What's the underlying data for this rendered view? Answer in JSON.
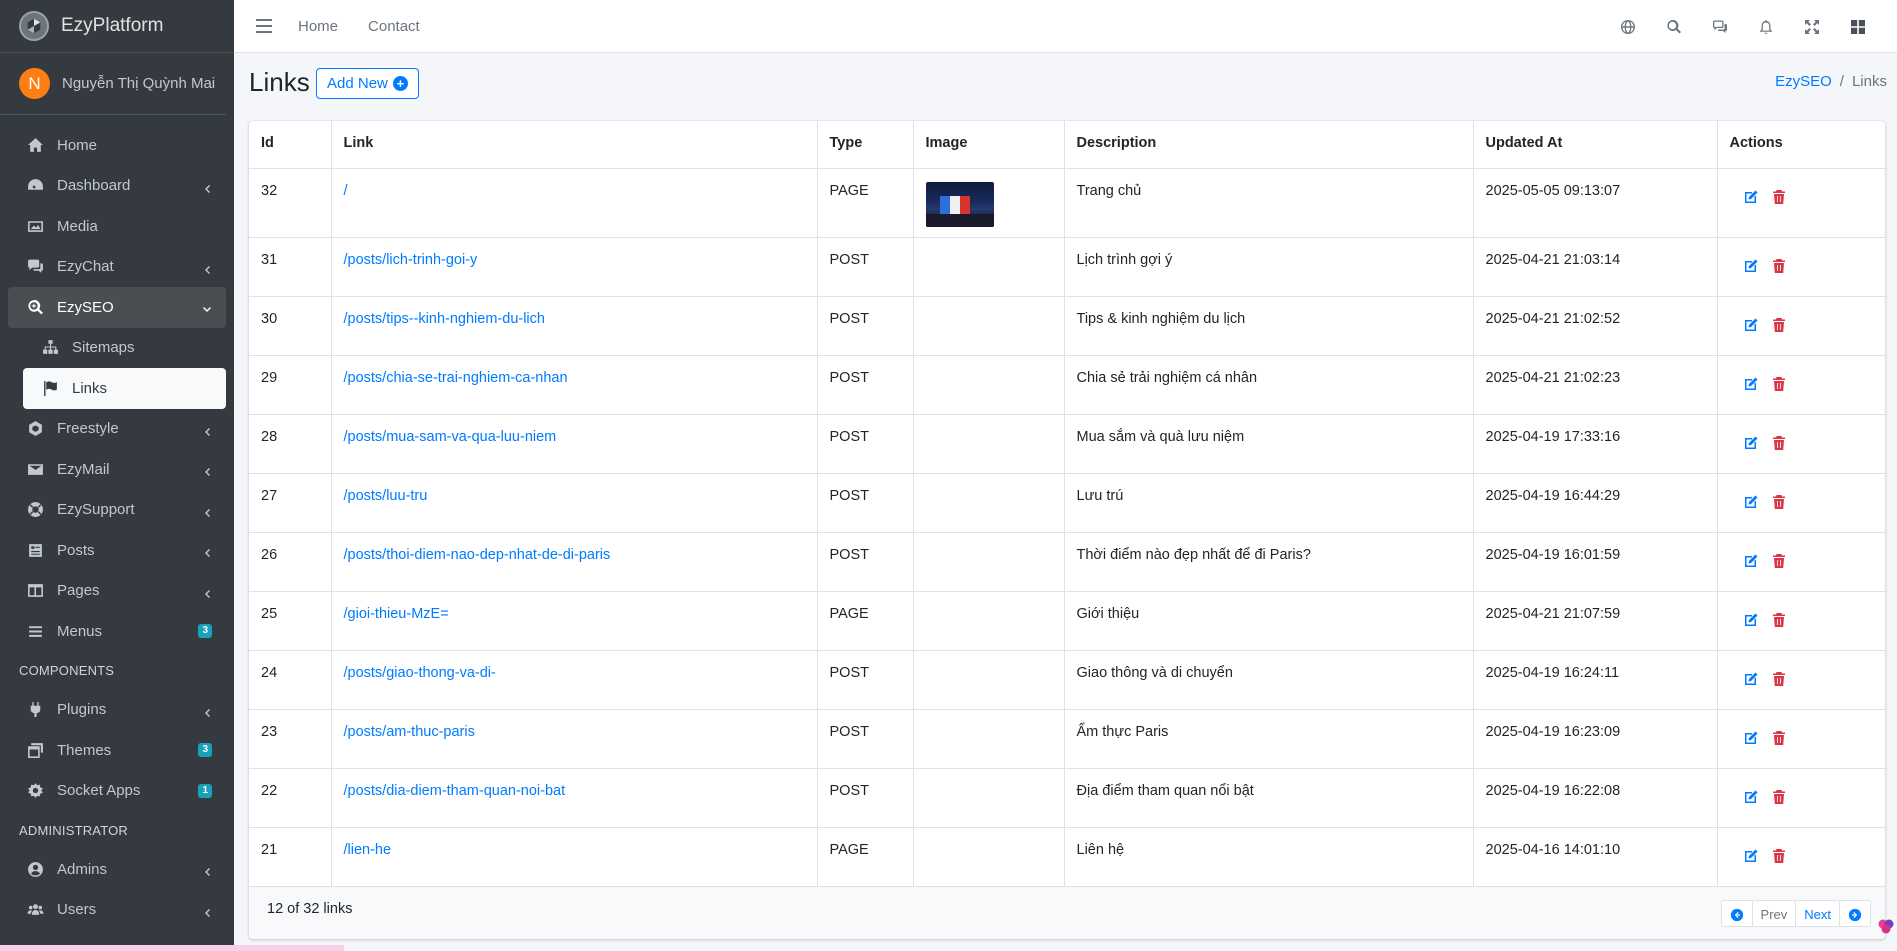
{
  "brand": {
    "name": "EzyPlatform"
  },
  "user": {
    "initial": "N",
    "name": "Nguyễn Thị Quỳnh Mai"
  },
  "sidebar": {
    "items": [
      {
        "label": "Home",
        "icon": "home-icon"
      },
      {
        "label": "Dashboard",
        "icon": "dashboard-icon"
      },
      {
        "label": "Media",
        "icon": "image-icon"
      },
      {
        "label": "EzyChat",
        "icon": "chat-icon"
      },
      {
        "label": "EzySEO",
        "icon": "search-plus-icon"
      },
      {
        "label": "Sitemaps",
        "icon": "sitemap-icon"
      },
      {
        "label": "Links",
        "icon": "flag-icon"
      },
      {
        "label": "Freestyle",
        "icon": "freestyle-icon"
      },
      {
        "label": "EzyMail",
        "icon": "mail-icon"
      },
      {
        "label": "EzySupport",
        "icon": "support-icon"
      },
      {
        "label": "Posts",
        "icon": "posts-icon"
      },
      {
        "label": "Pages",
        "icon": "pages-icon"
      },
      {
        "label": "Menus",
        "icon": "menu-icon",
        "badge": "3"
      }
    ],
    "components_header": "COMPONENTS",
    "components": [
      {
        "label": "Plugins",
        "icon": "plug-icon"
      },
      {
        "label": "Themes",
        "icon": "themes-icon",
        "badge": "3"
      },
      {
        "label": "Socket Apps",
        "icon": "socket-icon",
        "badge": "1"
      }
    ],
    "admin_header": "ADMINISTRATOR",
    "admin": [
      {
        "label": "Admins",
        "icon": "admin-icon"
      },
      {
        "label": "Users",
        "icon": "users-icon"
      }
    ]
  },
  "topbar": {
    "home": "Home",
    "contact": "Contact"
  },
  "page": {
    "title": "Links",
    "add_new": "Add New"
  },
  "breadcrumb": {
    "parent": "EzySEO",
    "sep": "/",
    "current": "Links"
  },
  "table": {
    "headers": [
      "Id",
      "Link",
      "Type",
      "Image",
      "Description",
      "Updated At",
      "Actions"
    ],
    "rows": [
      {
        "id": "32",
        "link": "/",
        "type": "PAGE",
        "description": "Trang chủ",
        "updated": "2025-05-05 09:13:07"
      },
      {
        "id": "31",
        "link": "/posts/lich-trinh-goi-y",
        "type": "POST",
        "description": "Lịch trình gợi ý",
        "updated": "2025-04-21 21:03:14"
      },
      {
        "id": "30",
        "link": "/posts/tips--kinh-nghiem-du-lich",
        "type": "POST",
        "description": "Tips & kinh nghiệm du lịch",
        "updated": "2025-04-21 21:02:52"
      },
      {
        "id": "29",
        "link": "/posts/chia-se-trai-nghiem-ca-nhan",
        "type": "POST",
        "description": "Chia sẻ trải nghiệm cá nhân",
        "updated": "2025-04-21 21:02:23"
      },
      {
        "id": "28",
        "link": "/posts/mua-sam-va-qua-luu-niem",
        "type": "POST",
        "description": "Mua sắm và quà lưu niệm",
        "updated": "2025-04-19 17:33:16"
      },
      {
        "id": "27",
        "link": "/posts/luu-tru",
        "type": "POST",
        "description": "Lưu trú",
        "updated": "2025-04-19 16:44:29"
      },
      {
        "id": "26",
        "link": "/posts/thoi-diem-nao-dep-nhat-de-di-paris",
        "type": "POST",
        "description": "Thời điểm nào đẹp nhất để đi Paris?",
        "updated": "2025-04-19 16:01:59"
      },
      {
        "id": "25",
        "link": "/gioi-thieu-MzE=",
        "type": "PAGE",
        "description": "Giới thiệu",
        "updated": "2025-04-21 21:07:59"
      },
      {
        "id": "24",
        "link": "/posts/giao-thong-va-di-",
        "type": "POST",
        "description": "Giao thông và di chuyển",
        "updated": "2025-04-19 16:24:11"
      },
      {
        "id": "23",
        "link": "/posts/am-thuc-paris",
        "type": "POST",
        "description": "Ẩm thực Paris",
        "updated": "2025-04-19 16:23:09"
      },
      {
        "id": "22",
        "link": "/posts/dia-diem-tham-quan-noi-bat",
        "type": "POST",
        "description": "Địa điểm tham quan nổi bật",
        "updated": "2025-04-19 16:22:08"
      },
      {
        "id": "21",
        "link": "/lien-he",
        "type": "PAGE",
        "description": "Liên hệ",
        "updated": "2025-04-16 14:01:10"
      }
    ]
  },
  "footer": {
    "count": "12 of 32 links",
    "prev": "Prev",
    "next": "Next"
  },
  "colors": {
    "primary": "#007bff",
    "danger": "#dc3545",
    "sidebar_bg": "#343a40",
    "badge": "#17a2b8",
    "avatar": "#fd7e14"
  }
}
